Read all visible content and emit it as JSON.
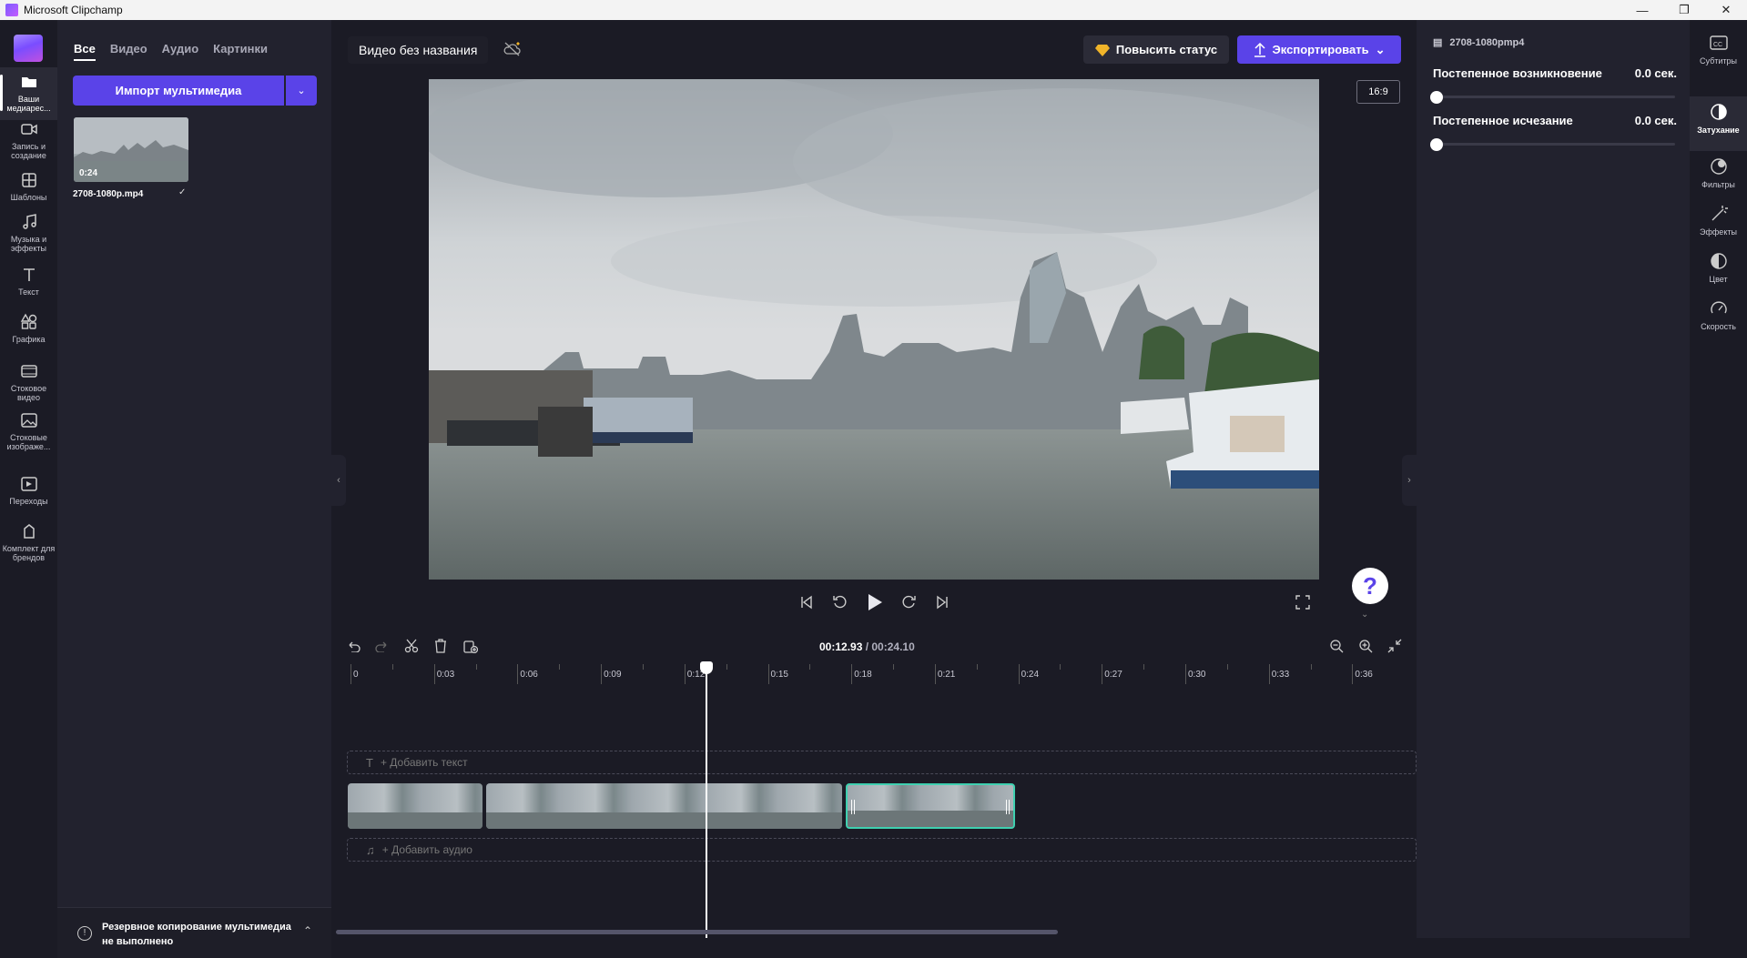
{
  "window": {
    "title": "Microsoft Clipchamp",
    "controls": [
      "—",
      "❐",
      "✕"
    ]
  },
  "left_rail": {
    "items": [
      {
        "label": "Ваши медиарес...",
        "icon": "folder-icon"
      },
      {
        "label": "Запись и создание",
        "icon": "camera-icon"
      },
      {
        "label": "Шаблоны",
        "icon": "templates-icon"
      },
      {
        "label": "Музыка и эффекты",
        "icon": "music-icon"
      },
      {
        "label": "Текст",
        "icon": "text-icon"
      },
      {
        "label": "Графика",
        "icon": "shapes-icon"
      },
      {
        "label": "Стоковое видео",
        "icon": "film-icon"
      },
      {
        "label": "Стоковые изображе...",
        "icon": "image-icon"
      },
      {
        "label": "Переходы",
        "icon": "transition-icon"
      },
      {
        "label": "Комплект для брендов",
        "icon": "brand-kit-icon"
      }
    ]
  },
  "media_panel": {
    "tabs": [
      "Все",
      "Видео",
      "Аудио",
      "Картинки"
    ],
    "import_label": "Импорт мультимедиа",
    "media": [
      {
        "name": "2708-1080p.mp4",
        "duration": "0:24"
      }
    ],
    "backup_text": "Резервное копирование мультимедиа не выполнено"
  },
  "header": {
    "project_title": "Видео без названия",
    "upgrade_label": "Повысить статус",
    "export_label": "Экспортировать"
  },
  "preview": {
    "aspect_ratio": "16:9",
    "help": "?"
  },
  "timeline": {
    "current_time": "00:12.93",
    "total_time": "/ 00:24.10",
    "ruler_labels": [
      "0",
      "0:03",
      "0:06",
      "0:09",
      "0:12",
      "0:15",
      "0:18",
      "0:21",
      "0:24",
      "0:27",
      "0:30",
      "0:33",
      "0:36"
    ],
    "add_text": "+ Добавить текст",
    "add_audio": "+ Добавить аудио",
    "playhead_time_seconds": 12.93
  },
  "right_panel": {
    "file_name": "2708-1080pmp4",
    "fade_in_label": "Постепенное возникновение",
    "fade_in_value": "0.0 сек.",
    "fade_out_label": "Постепенное исчезание",
    "fade_out_value": "0.0 сек."
  },
  "right_rail": {
    "items": [
      {
        "label": "Субтитры",
        "icon": "captions-icon"
      },
      {
        "label": "Затухание",
        "icon": "fade-icon"
      },
      {
        "label": "Фильтры",
        "icon": "filters-icon"
      },
      {
        "label": "Эффекты",
        "icon": "effects-icon"
      },
      {
        "label": "Цвет",
        "icon": "color-icon"
      },
      {
        "label": "Скорость",
        "icon": "speed-icon"
      }
    ]
  },
  "colors": {
    "accent": "#5a43e8",
    "selection": "#3fd0b0",
    "background": "#1b1b25",
    "panel": "#22222e"
  }
}
